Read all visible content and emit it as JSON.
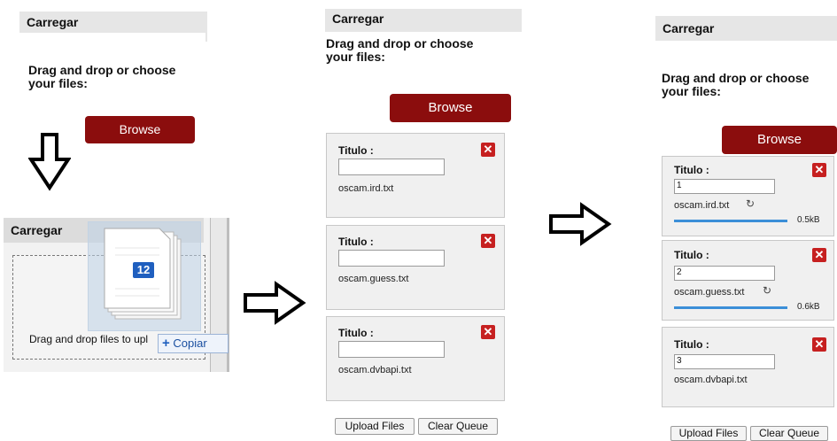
{
  "panel_initial": {
    "title": "Carregar",
    "prompt": "Drag and drop or choose your files:",
    "browse_label": "Browse"
  },
  "panel_drag": {
    "title": "Carregar",
    "drop_hint": "Drag and drop files to upl",
    "file_badge": "12",
    "copy_label": "Copiar"
  },
  "panel_queue": {
    "title": "Carregar",
    "prompt": "Drag and drop or choose your files:",
    "browse_label": "Browse",
    "items": [
      {
        "title_label": "Titulo :",
        "title_value": "",
        "file_name": "oscam.ird.txt"
      },
      {
        "title_label": "Titulo :",
        "title_value": "",
        "file_name": "oscam.guess.txt"
      },
      {
        "title_label": "Titulo :",
        "title_value": "",
        "file_name": "oscam.dvbapi.txt"
      }
    ],
    "upload_label": "Upload Files",
    "clear_label": "Clear Queue"
  },
  "panel_uploading": {
    "title": "Carregar",
    "prompt": "Drag and drop or choose your files:",
    "browse_label": "Browse",
    "items": [
      {
        "title_label": "Titulo :",
        "title_value": "1",
        "file_name": "oscam.ird.txt",
        "progress": 1.0,
        "size": "0.5kB"
      },
      {
        "title_label": "Titulo :",
        "title_value": "2",
        "file_name": "oscam.guess.txt",
        "progress": 1.0,
        "size": "0.6kB"
      },
      {
        "title_label": "Titulo :",
        "title_value": "3",
        "file_name": "oscam.dvbapi.txt"
      }
    ],
    "upload_label": "Upload Files",
    "clear_label": "Clear Queue"
  },
  "colors": {
    "browse": "#8b0d0d",
    "remove": "#c62020",
    "progress": "#3c8fd8",
    "header": "#e6e6e6"
  },
  "icons": [
    "arrow-down-icon",
    "arrow-right-icon",
    "remove-icon",
    "refresh-icon",
    "file-stack-icon",
    "plus-icon"
  ]
}
